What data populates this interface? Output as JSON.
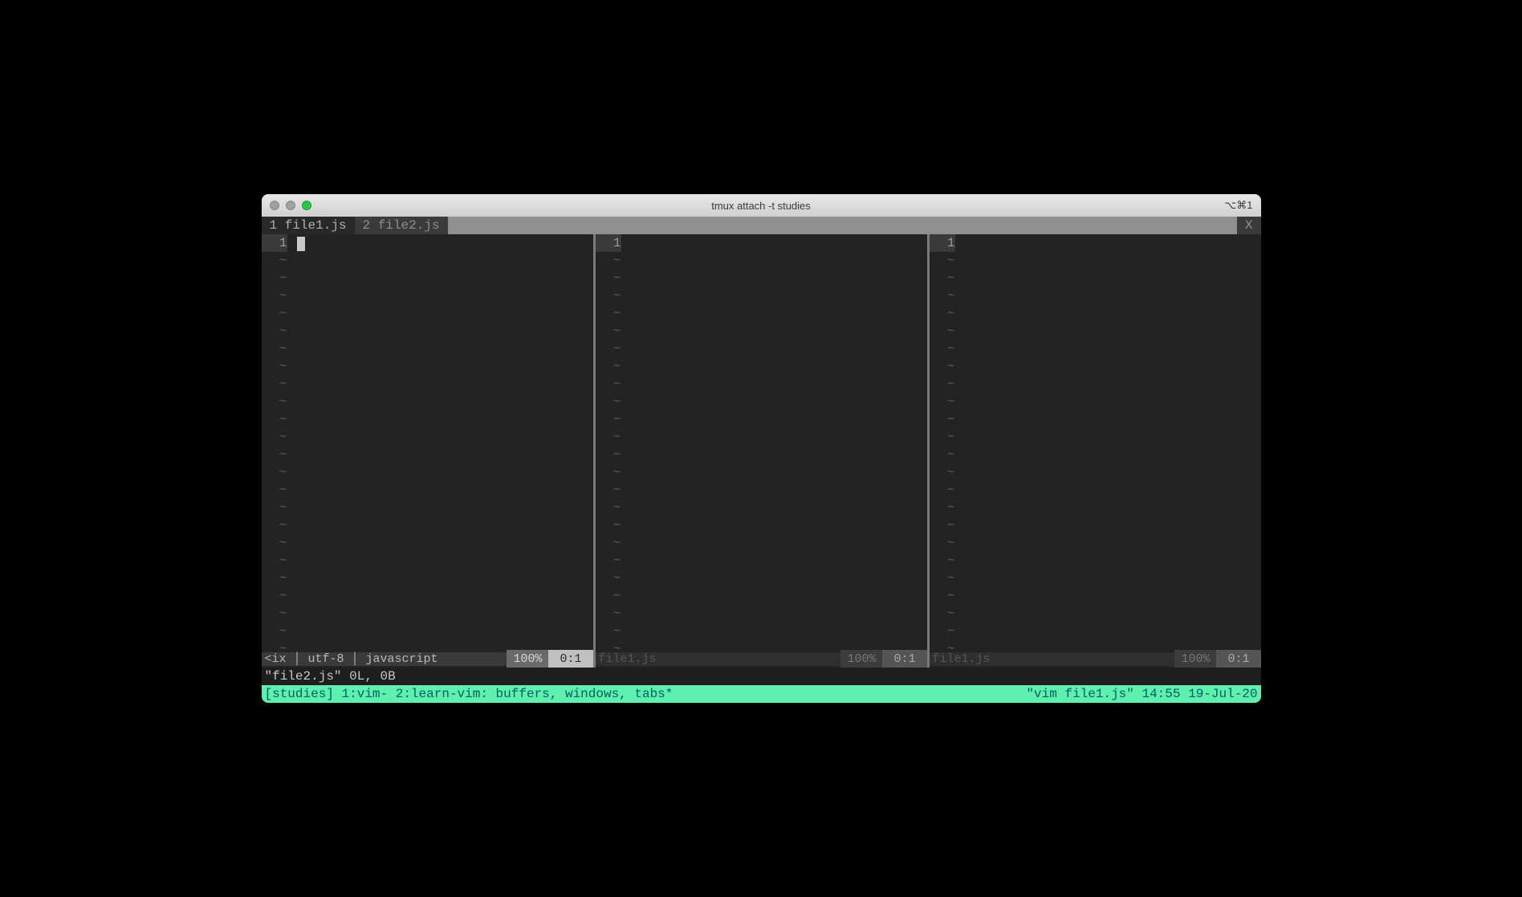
{
  "window": {
    "title": "tmux attach -t studies",
    "shortcut": "⌥⌘1"
  },
  "tabline": {
    "tabs": [
      {
        "index": "1",
        "label": "file1.js",
        "active": true
      },
      {
        "index": "2",
        "label": "file2.js",
        "active": false
      }
    ],
    "close": "X"
  },
  "splits": [
    {
      "active": true,
      "lineno": "1",
      "statusline_left": "<ix │ utf-8 │ javascript",
      "percent": "100%",
      "position": "0:1"
    },
    {
      "active": false,
      "lineno": "1",
      "statusline_left": "file1.js",
      "percent": "100%",
      "position": "0:1"
    },
    {
      "active": false,
      "lineno": "1",
      "statusline_left": "file1.js",
      "percent": "100%",
      "position": "0:1"
    }
  ],
  "cmdline": "\"file2.js\" 0L, 0B",
  "tmux": {
    "left": "[studies] 1:vim- 2:learn-vim: buffers, windows, tabs*",
    "right": "\"vim file1.js\" 14:55 19-Jul-20"
  },
  "tilde": "~"
}
